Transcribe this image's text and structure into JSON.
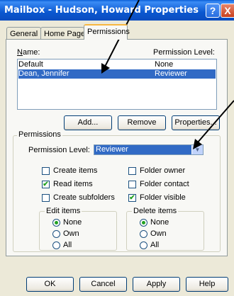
{
  "window": {
    "title": "Mailbox - Hudson, Howard Properties",
    "help_glyph": "?",
    "close_glyph": "X"
  },
  "tabs": [
    {
      "label": "General",
      "active": false
    },
    {
      "label": "Home Page",
      "active": false
    },
    {
      "label": "Permissions",
      "active": true
    }
  ],
  "permissions_list": {
    "name_header": "Name:",
    "level_header": "Permission Level:",
    "rows": [
      {
        "name": "Default",
        "level": "None",
        "selected": false
      },
      {
        "name": "Dean, Jennifer",
        "level": "Reviewer",
        "selected": true
      }
    ]
  },
  "list_buttons": {
    "add": "Add...",
    "remove": "Remove",
    "properties": "Properties..."
  },
  "permissions_group": {
    "title": "Permissions",
    "level_label": "Permission Level:",
    "level_value": "Reviewer",
    "checkboxes": [
      {
        "label": "Create items",
        "checked": false
      },
      {
        "label": "Folder owner",
        "checked": false
      },
      {
        "label": "Read items",
        "checked": true
      },
      {
        "label": "Folder contact",
        "checked": false
      },
      {
        "label": "Create subfolders",
        "checked": false
      },
      {
        "label": "Folder visible",
        "checked": true
      }
    ],
    "edit_items": {
      "title": "Edit items",
      "options": [
        {
          "label": "None",
          "selected": true
        },
        {
          "label": "Own",
          "selected": false
        },
        {
          "label": "All",
          "selected": false
        }
      ]
    },
    "delete_items": {
      "title": "Delete items",
      "options": [
        {
          "label": "None",
          "selected": true
        },
        {
          "label": "Own",
          "selected": false
        },
        {
          "label": "All",
          "selected": false
        }
      ]
    }
  },
  "dialog_buttons": {
    "ok": "OK",
    "cancel": "Cancel",
    "apply": "Apply",
    "help": "Help"
  },
  "colors": {
    "selection": "#316ac5",
    "title_bar": "#0a57d0",
    "dialog_face": "#ece9d8",
    "check_mark": "#21a121"
  }
}
